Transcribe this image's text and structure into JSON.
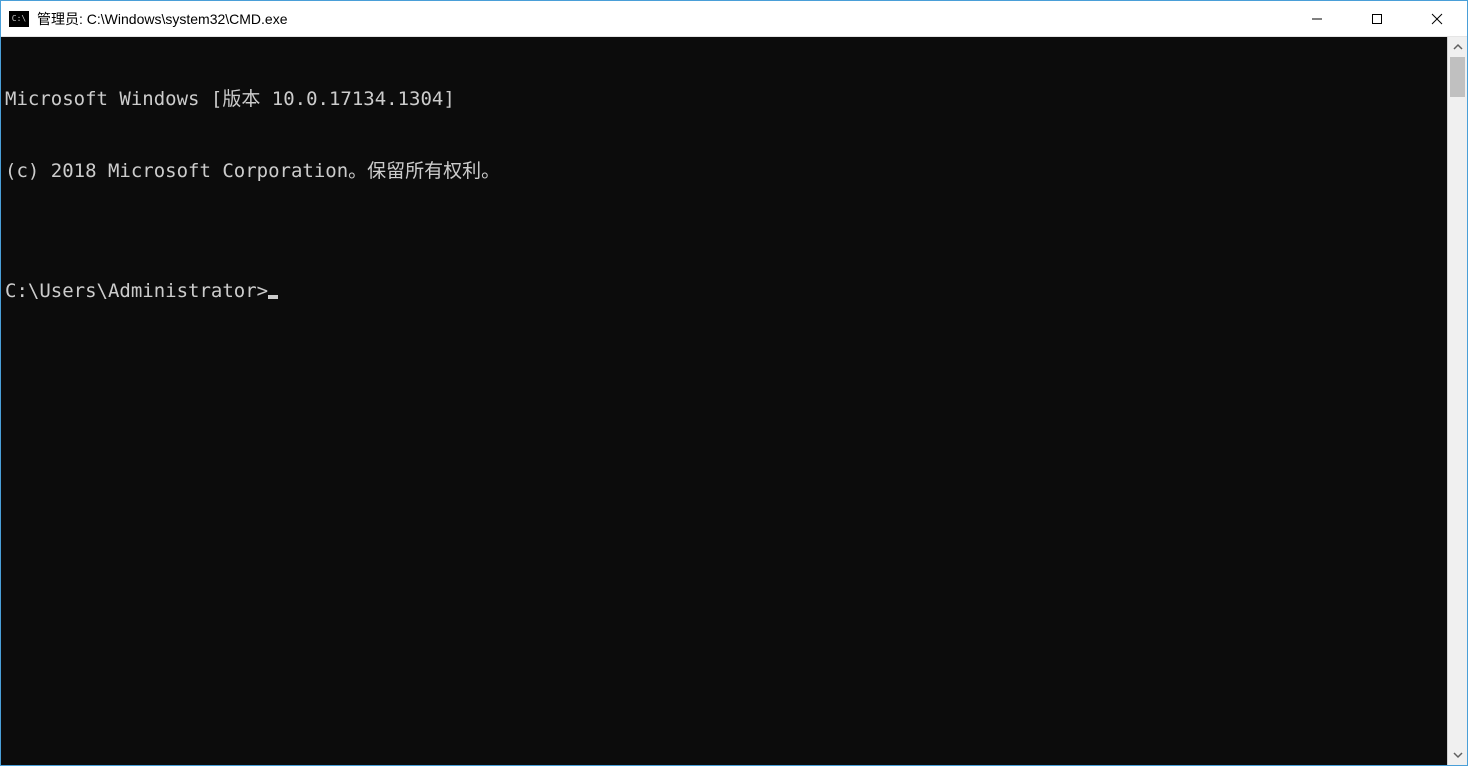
{
  "window": {
    "title": "管理员: C:\\Windows\\system32\\CMD.exe",
    "icon_label": "C:\\"
  },
  "terminal": {
    "line1": "Microsoft Windows [版本 10.0.17134.1304]",
    "line2": "(c) 2018 Microsoft Corporation。保留所有权利。",
    "blank": "",
    "prompt": "C:\\Users\\Administrator>"
  },
  "controls": {
    "minimize": "minimize",
    "maximize": "maximize",
    "close": "close"
  }
}
